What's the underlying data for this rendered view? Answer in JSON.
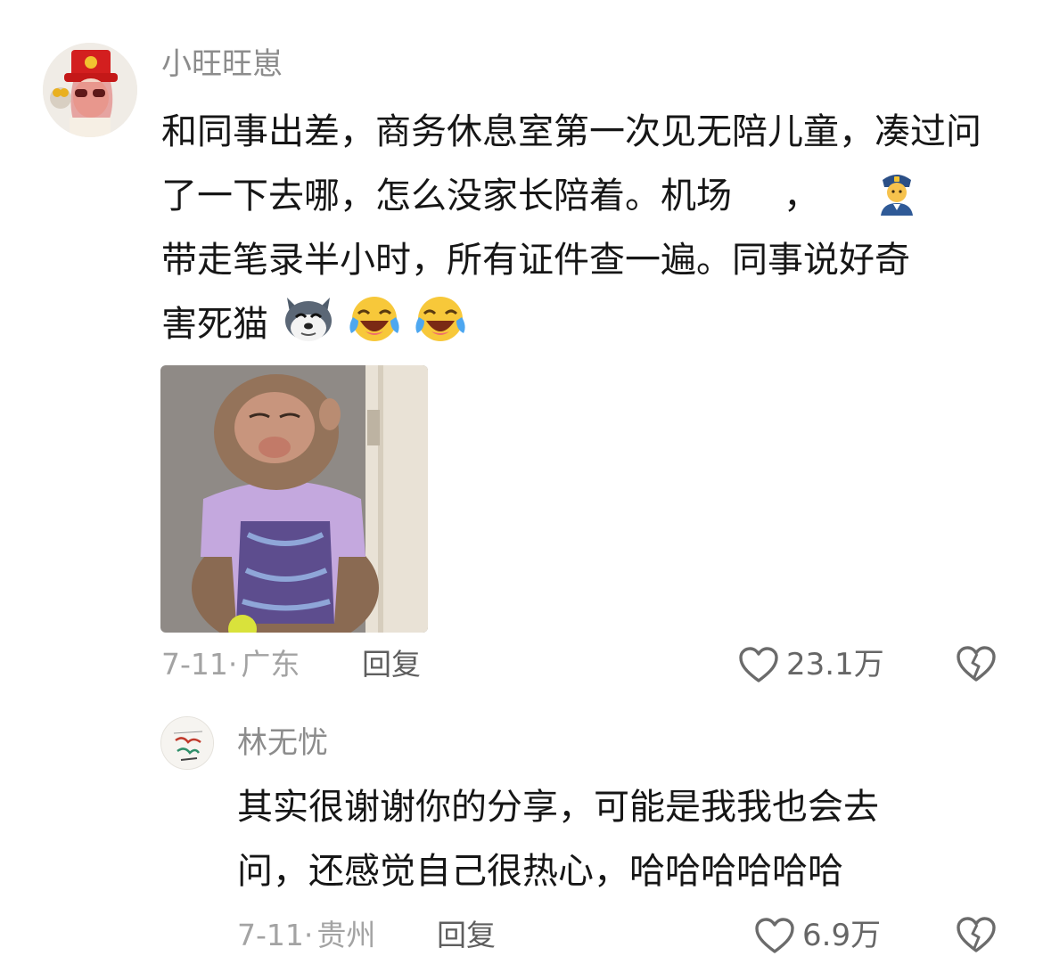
{
  "comments": [
    {
      "username": "小旺旺崽",
      "text": "和同事出差，商务休息室第一次见无陪儿童，凑过问了一下去哪，怎么没家长陪着。机场",
      "text_after_police_emoji": "，",
      "text_line3": "带走笔录半小时，所有证件查一遍。同事说好奇",
      "text_line4": "害死猫",
      "emojis": [
        "police-emoji",
        "husky-emoji",
        "crying-laughing-emoji",
        "crying-laughing-emoji"
      ],
      "date": "7-11",
      "separator": "·",
      "location": "广东",
      "reply_label": "回复",
      "like_count": "23.1万"
    },
    {
      "username": "林无忧",
      "text_line1": "其实很谢谢你的分享，可能是我我也会去",
      "text_line2": "问，还感觉自己很热心，哈哈哈哈哈哈",
      "date": "7-11",
      "separator": "·",
      "location": "贵州",
      "reply_label": "回复",
      "like_count": "6.9万"
    }
  ],
  "colors": {
    "text": "#161616",
    "meta": "#a3a3a3",
    "username": "#8c8c8c"
  }
}
